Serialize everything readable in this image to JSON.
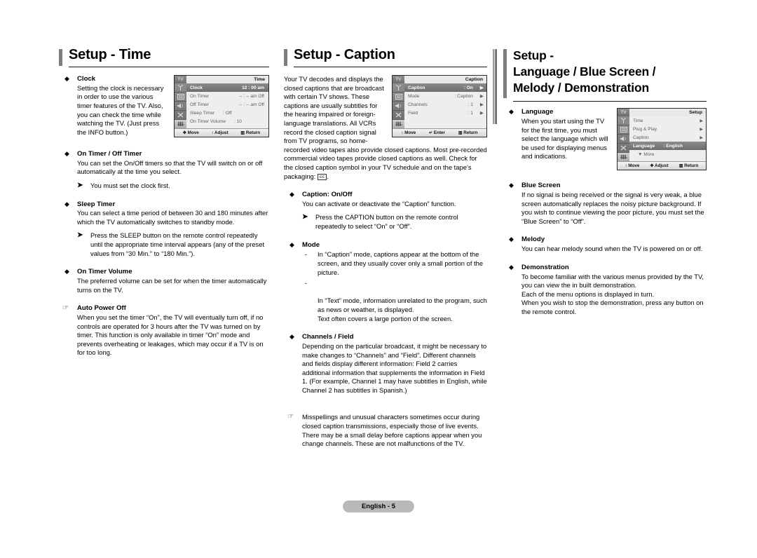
{
  "page": {
    "footer_label": "English - 5"
  },
  "columns": {
    "time": {
      "heading": "Setup - Time",
      "osd": {
        "tv_label": "TV",
        "title": "Time",
        "rows": [
          {
            "label": "Clock",
            "value": "12 : 00 am",
            "highlight": true
          },
          {
            "label": "On Timer",
            "value": "-- : --   am   Off",
            "highlight": false
          },
          {
            "label": "Off Timer",
            "value": "-- : --   am   Off",
            "highlight": false
          },
          {
            "label": "Sleep Timer",
            "value": ": Off",
            "highlight": false
          },
          {
            "label": "On Timer Volume",
            "value": ": 10",
            "highlight": false
          }
        ],
        "footer": [
          "Move",
          "Adjust",
          "Return"
        ]
      },
      "sections": [
        {
          "marker": "diamond",
          "title": "Clock",
          "body": "Setting the clock is necessary in order to use the various timer features of the TV. Also, you can check the time while watching the TV. (Just press the INFO button.)"
        },
        {
          "marker": "diamond",
          "title": "On Timer / Off Timer",
          "body": "You can set the On/Off timers so that the TV will switch on or off automatically at the time you select.",
          "note": "You must set the clock first."
        },
        {
          "marker": "diamond",
          "title": "Sleep Timer",
          "body": "You can select a time period of between 30 and 180 minutes after which the TV automatically switches to standby mode.",
          "note": "Press the SLEEP button on the remote control repeatedly until the appropriate time interval appears (any of the preset values from “30 Min.” to “180 Min.”)."
        },
        {
          "marker": "diamond",
          "title": "On Timer Volume",
          "body": "The preferred volume can be set for when the timer automatically turns on the TV."
        },
        {
          "marker": "hand",
          "title": "Auto Power Off",
          "body": "When you set the timer “On”, the TV will eventually turn off, if no controls are operated for 3 hours after the TV was turned on by timer. This function is only available in timer “On” mode and prevents overheating or leakages, which may occur if a TV is on for too long."
        }
      ]
    },
    "caption": {
      "heading": "Setup - Caption",
      "osd": {
        "tv_label": "TV",
        "title": "Caption",
        "rows": [
          {
            "label": "Caption",
            "value": ": On",
            "arrow": "▶",
            "highlight": true
          },
          {
            "label": "Mode",
            "value": ": Caption",
            "arrow": "▶",
            "highlight": false
          },
          {
            "label": "Channels",
            "value": ": 1",
            "arrow": "▶",
            "highlight": false
          },
          {
            "label": "Field",
            "value": ": 1",
            "arrow": "▶",
            "highlight": false
          }
        ],
        "footer": [
          "Move",
          "Enter",
          "Return"
        ]
      },
      "intro": "Your TV decodes and displays the closed captions that are broadcast with certain TV shows. These captions are usually subtitles for the hearing impaired or foreign-language translations. All VCRs record the closed caption signal from TV programs, so home-recorded video tapes also provide closed captions. Most pre-recorded commercial video tapes provide closed captions as well. Check for the closed caption symbol in your TV schedule and on the tape’s packaging:",
      "cc_symbol": "cc",
      "sections": [
        {
          "marker": "diamond",
          "title": "Caption: On/Off",
          "body": "You can activate or deactivate the “Caption” function.",
          "note": "Press the CAPTION button on the remote control repeatedly to select “On” or “Off”."
        },
        {
          "marker": "diamond",
          "title": "Mode",
          "dashes": [
            "In “Caption” mode, captions appear at the bottom of the screen, and they usually cover only a small portion of the picture.",
            "In “Text” mode, information unrelated to the program, such as news or weather, is displayed.\nText often covers a large portion of the screen."
          ]
        },
        {
          "marker": "diamond",
          "title": "Channels / Field",
          "body": "Depending on the particular broadcast, it might be necessary to make changes to “Channels” and “Field”. Different channels and fields display different information: Field 2 carries additional information that supplements the information in Field 1. (For example, Channel 1 may have subtitles in English, while Channel 2 has subtitles in Spanish.)"
        },
        {
          "marker": "hand",
          "title": "",
          "body": "Misspellings and unusual characters sometimes occur during closed caption transmissions, especially those of live events. There may be a small delay before captions appear when you change channels. These are not malfunctions of the TV."
        }
      ]
    },
    "language": {
      "heading": "Setup -\nLanguage / Blue Screen /\nMelody / Demonstration",
      "osd": {
        "tv_label": "TV",
        "title": "Setup",
        "rows": [
          {
            "label": "Time",
            "value": "",
            "arrow": "▶",
            "highlight": false
          },
          {
            "label": "Plug & Play",
            "value": "",
            "arrow": "▶",
            "highlight": false
          },
          {
            "label": "Caption",
            "value": "",
            "arrow": "▶",
            "highlight": false
          },
          {
            "label": "Language",
            "value": ": English",
            "arrow": "",
            "highlight": true
          },
          {
            "label": "▼ More",
            "value": "",
            "arrow": "",
            "highlight": false
          }
        ],
        "footer": [
          "Move",
          "Adjust",
          "Return"
        ]
      },
      "sections": [
        {
          "marker": "diamond",
          "title": "Language",
          "body": "When you start using the TV for the first time, you must select the language which will be used for displaying menus and indications."
        },
        {
          "marker": "diamond",
          "title": "Blue Screen",
          "body": "If no signal is being received or the signal is very weak, a blue screen automatically replaces the noisy picture background. If you wish to continue viewing the poor picture, you must set the “Blue Screen” to “Off”."
        },
        {
          "marker": "diamond",
          "title": "Melody",
          "body": "You can hear melody sound when the TV is powered on or off."
        },
        {
          "marker": "diamond",
          "title": "Demonstration",
          "body": "To become familiar with the various menus provided by the TV, you can view the in built demonstration.\nEach of the menu options is displayed in turn.\nWhen you wish to stop the demonstration, press any button on the remote control."
        }
      ]
    }
  },
  "icons": {
    "diamond": "◆",
    "hand": "☞",
    "arrow_note": "➤",
    "dash": "-",
    "move": "✥",
    "adjust": "↕",
    "enter": "↵",
    "return": "▥"
  }
}
